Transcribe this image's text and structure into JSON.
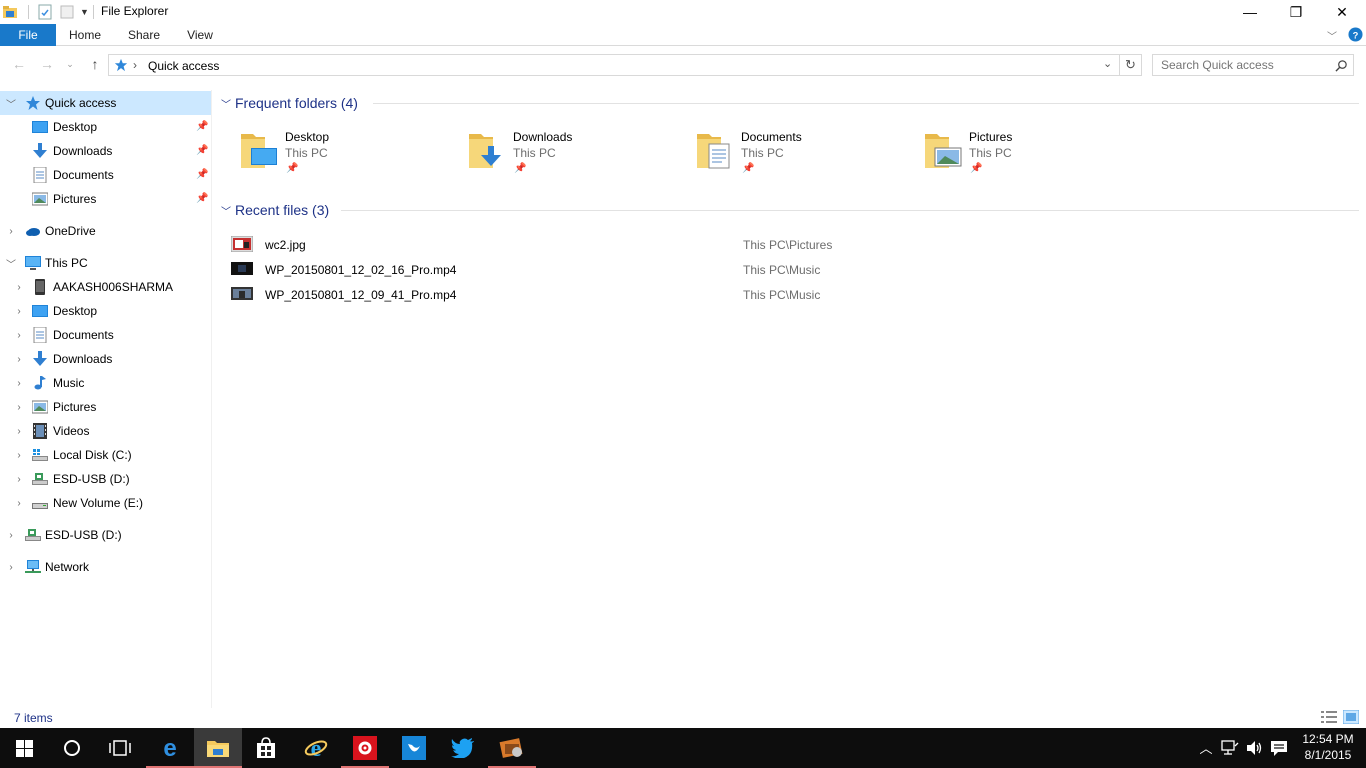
{
  "window": {
    "title": "File Explorer",
    "controls": {
      "minimize": "—",
      "maximize": "❐",
      "close": "✕"
    }
  },
  "ribbon": {
    "tabs": [
      {
        "label": "File",
        "active": true
      },
      {
        "label": "Home"
      },
      {
        "label": "Share"
      },
      {
        "label": "View"
      }
    ]
  },
  "address_bar": {
    "path": "Quick access",
    "separator": "›"
  },
  "search": {
    "placeholder": "Search Quick access"
  },
  "sidebar": {
    "items": [
      {
        "label": "Quick access",
        "icon": "star-icon",
        "expanded": true,
        "selected": true
      },
      {
        "label": "Desktop",
        "icon": "desktop-icon",
        "pinned": true
      },
      {
        "label": "Downloads",
        "icon": "downloads-icon",
        "pinned": true
      },
      {
        "label": "Documents",
        "icon": "documents-icon",
        "pinned": true
      },
      {
        "label": "Pictures",
        "icon": "pictures-icon",
        "pinned": true
      },
      {
        "label": "OneDrive",
        "icon": "onedrive-icon"
      },
      {
        "label": "This PC",
        "icon": "this-pc-icon",
        "expanded": true
      },
      {
        "label": "AAKASH006SHARMA",
        "icon": "phone-icon"
      },
      {
        "label": "Desktop",
        "icon": "desktop-icon"
      },
      {
        "label": "Documents",
        "icon": "documents-icon"
      },
      {
        "label": "Downloads",
        "icon": "downloads-icon"
      },
      {
        "label": "Music",
        "icon": "music-icon"
      },
      {
        "label": "Pictures",
        "icon": "pictures-icon"
      },
      {
        "label": "Videos",
        "icon": "videos-icon"
      },
      {
        "label": "Local Disk (C:)",
        "icon": "local-disk-icon"
      },
      {
        "label": "ESD-USB (D:)",
        "icon": "usb-drive-icon"
      },
      {
        "label": "New Volume (E:)",
        "icon": "drive-icon"
      },
      {
        "label": "ESD-USB (D:)",
        "icon": "usb-drive-icon"
      },
      {
        "label": "Network",
        "icon": "network-icon"
      }
    ]
  },
  "content": {
    "frequent": {
      "title": "Frequent folders (4)",
      "folders": [
        {
          "name": "Desktop",
          "location": "This PC",
          "icon": "desktop-folder-icon"
        },
        {
          "name": "Downloads",
          "location": "This PC",
          "icon": "downloads-folder-icon"
        },
        {
          "name": "Documents",
          "location": "This PC",
          "icon": "documents-folder-icon"
        },
        {
          "name": "Pictures",
          "location": "This PC",
          "icon": "pictures-folder-icon"
        }
      ]
    },
    "recent": {
      "title": "Recent files (3)",
      "files": [
        {
          "name": "wc2.jpg",
          "location": "This PC\\Pictures",
          "icon": "image-file-icon"
        },
        {
          "name": "WP_20150801_12_02_16_Pro.mp4",
          "location": "This PC\\Music",
          "icon": "video-file-icon"
        },
        {
          "name": "WP_20150801_12_09_41_Pro.mp4",
          "location": "This PC\\Music",
          "icon": "video-file-icon"
        }
      ]
    }
  },
  "status": {
    "items": "7 items"
  },
  "taskbar": {
    "apps": [
      {
        "name": "start",
        "icon": "windows-start-icon"
      },
      {
        "name": "cortana",
        "icon": "cortana-circle-icon"
      },
      {
        "name": "task-view",
        "icon": "task-view-icon"
      },
      {
        "name": "edge",
        "icon": "edge-icon"
      },
      {
        "name": "file-explorer",
        "icon": "file-explorer-icon",
        "active": true
      },
      {
        "name": "store",
        "icon": "store-icon"
      },
      {
        "name": "internet-explorer",
        "icon": "internet-explorer-icon"
      },
      {
        "name": "settings-app",
        "icon": "red-gear-app-icon"
      },
      {
        "name": "app-blue",
        "icon": "blue-app-icon"
      },
      {
        "name": "twitter",
        "icon": "twitter-icon"
      },
      {
        "name": "media-app",
        "icon": "media-app-icon"
      }
    ],
    "time": "12:54 PM",
    "date": "8/1/2015"
  },
  "colors": {
    "accent": "#1979ca",
    "header_text": "#1e3287",
    "selection": "#cce8ff",
    "taskbar": "#0d0d0d",
    "folder": "#f4c95d"
  }
}
